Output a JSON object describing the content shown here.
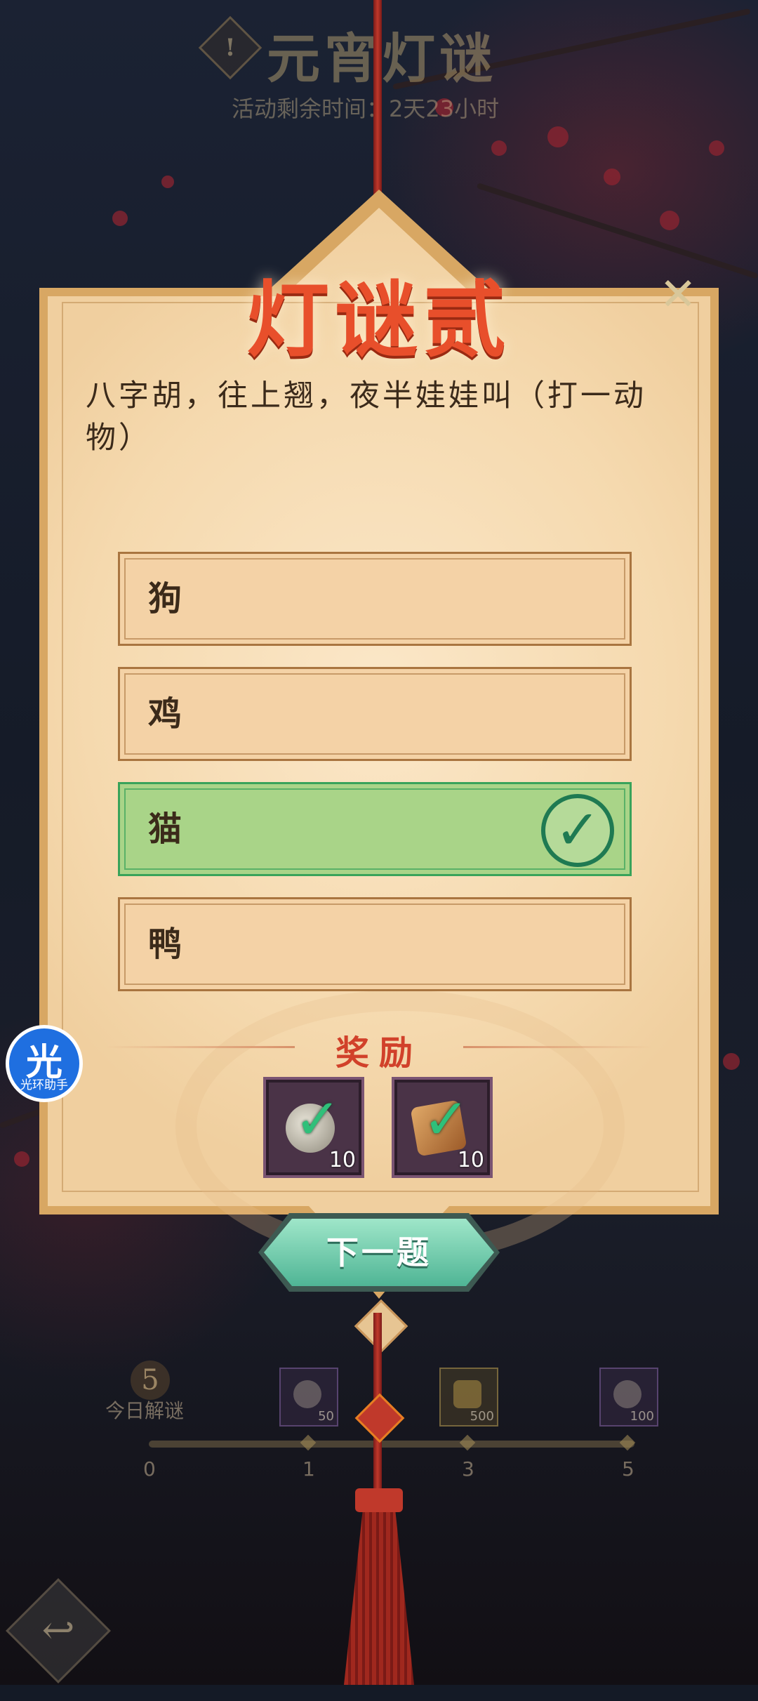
{
  "header": {
    "title": "元宵灯谜",
    "timer": "活动剩余时间：2天23小时",
    "warning_icon": "exclamation-icon"
  },
  "card": {
    "title": "灯谜贰",
    "close_glyph": "✕",
    "question": "八字胡，往上翘，夜半娃娃叫（打一动物）",
    "options": [
      {
        "label": "狗",
        "state": "normal"
      },
      {
        "label": "鸡",
        "state": "normal"
      },
      {
        "label": "猫",
        "state": "correct"
      },
      {
        "label": "鸭",
        "state": "normal"
      }
    ],
    "check_glyph": "✓",
    "reward_label": "奖励",
    "rewards": [
      {
        "icon": "pearl-scroll-icon",
        "qty": "10"
      },
      {
        "icon": "ink-stone-icon",
        "qty": "10"
      }
    ],
    "next_button": "下一题"
  },
  "progress": {
    "count": "5",
    "label": "今日解谜",
    "ticks": [
      "0",
      "1",
      "3",
      "5"
    ],
    "milestone_rewards": [
      {
        "icon": "pearl-icon",
        "qty": "50"
      },
      {
        "icon": "gold-ingot-icon",
        "qty": "500"
      },
      {
        "icon": "pearl-icon",
        "qty": "100"
      }
    ]
  },
  "assistant": {
    "glyph": "光",
    "label": "光环助手"
  },
  "back_glyph": "↩",
  "colors": {
    "title_red": "#e84f2b",
    "correct_green": "#a9d488",
    "card_parchment": "#f5d9ae",
    "button_teal": "#4fb595"
  }
}
